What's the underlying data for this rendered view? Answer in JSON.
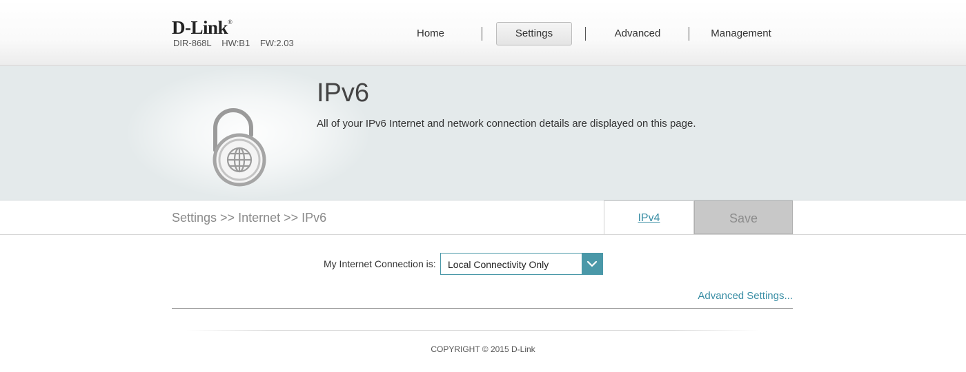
{
  "header": {
    "logo_text": "D-Link",
    "logo_mark": "®",
    "model": "DIR-868L",
    "hardware": "HW:B1",
    "firmware": "FW:2.03"
  },
  "nav": {
    "items": [
      {
        "label": "Home"
      },
      {
        "label": "Settings",
        "active": true
      },
      {
        "label": "Advanced"
      },
      {
        "label": "Management"
      }
    ]
  },
  "banner": {
    "icon": "unlocked-globe-icon",
    "title": "IPv6",
    "description": "All of your IPv6 Internet and network connection details are displayed on this page."
  },
  "breadcrumb": "Settings >> Internet >> IPv6",
  "actions": {
    "ipv4_label": "IPv4",
    "save_label": "Save"
  },
  "form": {
    "connection_label": "My Internet Connection is:",
    "connection_value": "Local Connectivity Only",
    "advanced_link": "Advanced Settings..."
  },
  "footer": {
    "copyright": "COPYRIGHT © 2015 D-Link"
  },
  "colors": {
    "accent": "#4a98a8",
    "link": "#3a8ea5",
    "banner_bg": "#e4eaeb",
    "save_bg": "#c8c8c8"
  }
}
